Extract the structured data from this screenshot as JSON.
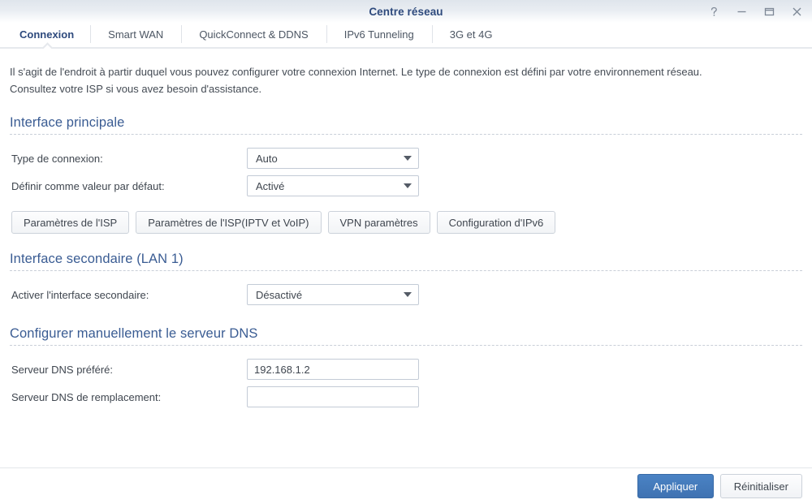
{
  "window": {
    "title": "Centre réseau",
    "controls": [
      {
        "name": "help-icon",
        "glyph": "?"
      },
      {
        "name": "minimize-icon",
        "glyph": "—"
      },
      {
        "name": "maximize-icon",
        "glyph": "□"
      },
      {
        "name": "close-icon",
        "glyph": "×"
      }
    ]
  },
  "tabs": [
    {
      "label": "Connexion",
      "active": true
    },
    {
      "label": "Smart WAN",
      "active": false
    },
    {
      "label": "QuickConnect & DDNS",
      "active": false
    },
    {
      "label": "IPv6 Tunneling",
      "active": false
    },
    {
      "label": "3G et 4G",
      "active": false
    }
  ],
  "intro": "Il s'agit de l'endroit à partir duquel vous pouvez configurer votre connexion Internet. Le type de connexion est défini par votre environnement réseau. Consultez votre ISP si vous avez besoin d'assistance.",
  "sections": {
    "primary": {
      "title": "Interface principale",
      "fields": [
        {
          "label": "Type de connexion:",
          "value": "Auto",
          "type": "select"
        },
        {
          "label": "Définir comme valeur par défaut:",
          "value": "Activé",
          "type": "select"
        }
      ],
      "buttons": [
        "Paramètres de l'ISP",
        "Paramètres de l'ISP(IPTV et VoIP)",
        "VPN paramètres",
        "Configuration d'IPv6"
      ]
    },
    "secondary": {
      "title": "Interface secondaire (LAN 1)",
      "fields": [
        {
          "label": "Activer l'interface secondaire:",
          "value": "Désactivé",
          "type": "select"
        }
      ]
    },
    "dns": {
      "title": "Configurer manuellement le serveur DNS",
      "fields": [
        {
          "label": "Serveur DNS préféré:",
          "value": "192.168.1.2",
          "placeholder": "",
          "type": "text"
        },
        {
          "label": "Serveur DNS de remplacement:",
          "value": "",
          "placeholder": "",
          "type": "text"
        }
      ]
    }
  },
  "footer": {
    "apply_label": "Appliquer",
    "reset_label": "Réinitialiser"
  },
  "colors": {
    "title": "#2e4a7d",
    "section_heading": "#3a5c93",
    "primary_button": "#3f72b2",
    "body_text": "#3f464f"
  }
}
